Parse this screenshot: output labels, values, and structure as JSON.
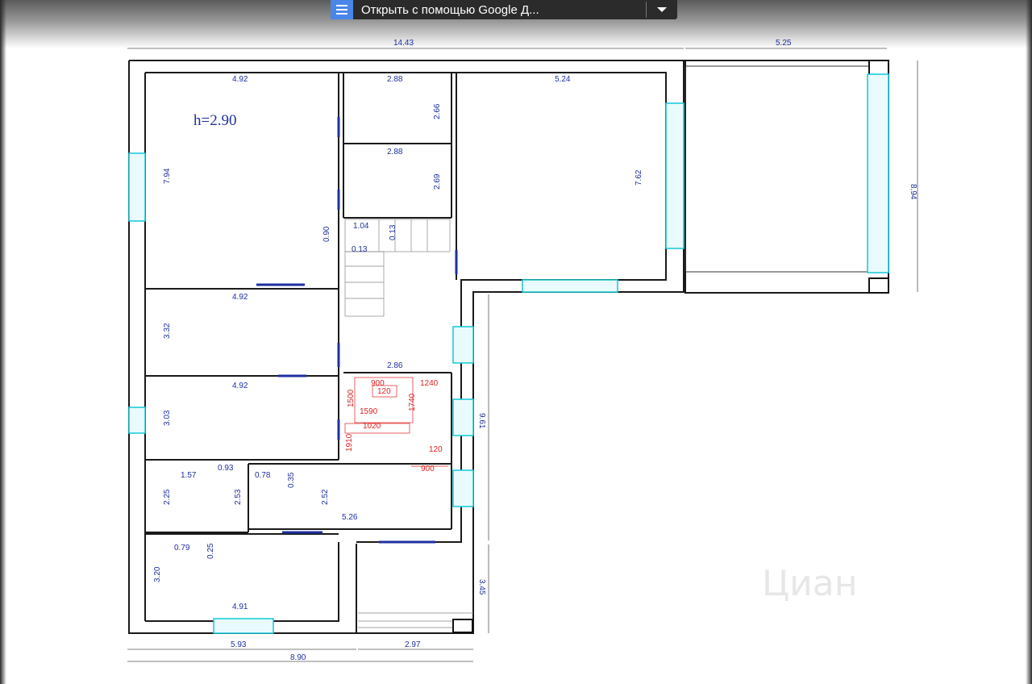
{
  "toolbar": {
    "open_with_label": "Открыть с помощью Google Д...",
    "doc_icon": "google-docs-icon",
    "dropdown_icon": "caret-down-icon"
  },
  "plan": {
    "height_label": "h=2.90",
    "watermark": "Циан",
    "outer_dims": {
      "top_main": "14.43",
      "top_veranda": "5.25",
      "right_veranda": "8.94",
      "right_corridor": "9.61",
      "right_porch": "3.45",
      "bottom_total": "8.90",
      "bottom_left": "5.93",
      "bottom_porch": "2.97"
    },
    "rooms": {
      "r1_w": "4.92",
      "r1_h": "7.94",
      "r2_w": "2.88",
      "r2_h": "2.66",
      "r3_w": "2.88",
      "r3_h": "2.69",
      "r4_w": "5.24",
      "r4_h": "7.62",
      "stair_w": "1.04",
      "stair_h": "0.90",
      "stair_gap": "0.13",
      "stair_gap2": "0.13",
      "r5_w": "4.92",
      "r5_h": "3.32",
      "hall_w": "2.86",
      "r6_w": "4.92",
      "r6_h": "3.03",
      "r7_w1": "1.57",
      "r7_w2": "0.93",
      "r7_h1": "2.25",
      "r7_h2": "2.53",
      "r8_w": "0.78",
      "r8_h": "0.35",
      "r8_h2": "2.52",
      "r9_w": "5.26",
      "r10_w1": "0.79",
      "r10_h1": "0.25",
      "r10_h": "3.20",
      "r10_w": "4.91"
    },
    "bath_marks": [
      "900",
      "1240",
      "120",
      "1500",
      "1740",
      "1590",
      "1020",
      "1910",
      "120",
      "900"
    ]
  }
}
